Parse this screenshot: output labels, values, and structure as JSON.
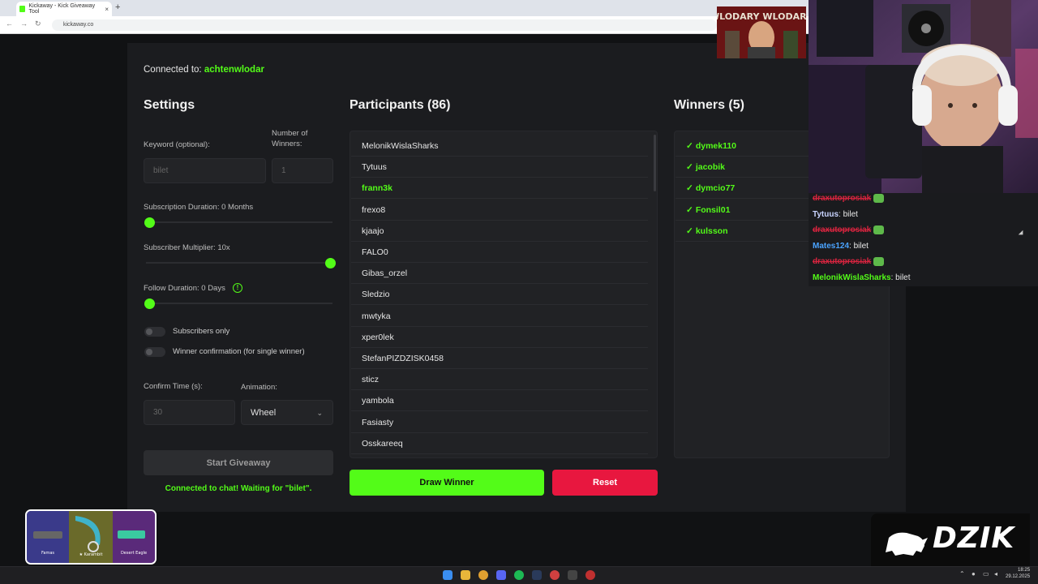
{
  "browser": {
    "tab_title": "Kickaway - Kick Giveaway Tool",
    "tab_close": "×",
    "new_tab": "+",
    "url": "kickaway.co",
    "back": "←",
    "forward": "→",
    "reload": "↻"
  },
  "connection": {
    "prefix": "Connected to: ",
    "channel": "achtenwlodar"
  },
  "settings": {
    "title": "Settings",
    "keyword_label": "Keyword (optional):",
    "keyword_placeholder": "bilet",
    "winners_label": "Number of Winners:",
    "winners_placeholder": "1",
    "sub_duration_label": "Subscription Duration: 0 Months",
    "sub_duration_value": 0,
    "sub_multiplier_label": "Subscriber Multiplier: 10x",
    "sub_multiplier_value": 1.0,
    "follow_duration_label": "Follow Duration: 0 Days",
    "follow_duration_value": 0,
    "info_glyph": "!",
    "subscribers_only_label": "Subscribers only",
    "winner_confirm_label": "Winner confirmation (for single winner)",
    "confirm_time_label": "Confirm Time (s):",
    "confirm_time_placeholder": "30",
    "animation_label": "Animation:",
    "animation_value": "Wheel",
    "chevron": "⌄",
    "start_button": "Start Giveaway",
    "status": "Connected to chat! Waiting for \"bilet\"."
  },
  "participants": {
    "title": "Participants (86)",
    "items": [
      {
        "name": "MelonikWislaSharks",
        "winner": false
      },
      {
        "name": "Tytuus",
        "winner": false
      },
      {
        "name": "frann3k",
        "winner": true
      },
      {
        "name": "frexo8",
        "winner": false
      },
      {
        "name": "kjaajo",
        "winner": false
      },
      {
        "name": "FALO0",
        "winner": false
      },
      {
        "name": "Gibas_orzel",
        "winner": false
      },
      {
        "name": "Sledzio",
        "winner": false
      },
      {
        "name": "mwtyka",
        "winner": false
      },
      {
        "name": "xper0lek",
        "winner": false
      },
      {
        "name": "StefanPIZDZISK0458",
        "winner": false
      },
      {
        "name": "sticz",
        "winner": false
      },
      {
        "name": "yambola",
        "winner": false
      },
      {
        "name": "Fasiasty",
        "winner": false
      },
      {
        "name": "Osskareeq",
        "winner": false
      }
    ],
    "draw_button": "Draw Winner",
    "reset_button": "Reset"
  },
  "winners": {
    "title": "Winners (5)",
    "check": "✓",
    "items": [
      "dymek110",
      "jacobik",
      "dymcio77",
      "Fonsil01",
      "kulsson"
    ]
  },
  "chat": {
    "messages": [
      {
        "user": "draxutoprosiak",
        "text": "",
        "struck": true,
        "color": "#d9243f"
      },
      {
        "user": "Tytuus",
        "text": ": bilet",
        "struck": false,
        "color": "#c9d4ff"
      },
      {
        "user": "draxutoprosiak",
        "text": "",
        "struck": true,
        "color": "#d9243f"
      },
      {
        "user": "Mates124",
        "text": ": bilet",
        "struck": false,
        "color": "#4aa3ff"
      },
      {
        "user": "draxutoprosiak",
        "text": "",
        "struck": true,
        "color": "#d9243f"
      },
      {
        "user": "MelonikWislaSharks",
        "text": ": bilet",
        "struck": false,
        "color": "#53fc18"
      }
    ]
  },
  "overlays": {
    "banner_text": "WLODARY WLODARA",
    "logo_text": "DZIK",
    "case_items": [
      "Famas",
      "★ Karambit",
      "Desert Eagle"
    ]
  },
  "taskbar": {
    "time": "18:25",
    "date": "29.12.2025"
  },
  "colors": {
    "accent": "#53fc18",
    "danger": "#e8173f",
    "page_bg": "#1b1c1f",
    "panel_bg": "#212225"
  }
}
